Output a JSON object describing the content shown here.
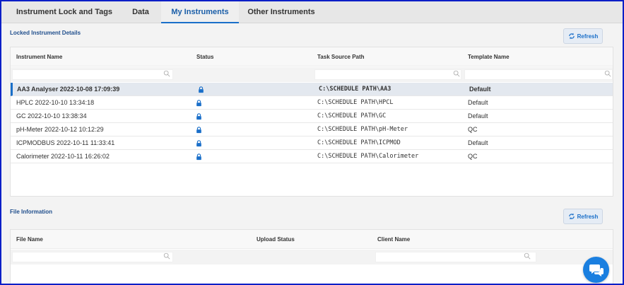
{
  "tabs": [
    {
      "label": "Instrument Lock and Tags"
    },
    {
      "label": "Data"
    },
    {
      "label": "My Instruments"
    },
    {
      "label": "Other Instruments"
    }
  ],
  "locked": {
    "title": "Locked Instrument Details",
    "refresh_label": "Refresh",
    "columns": [
      "Instrument Name",
      "Status",
      "Task Source Path",
      "Template Name"
    ],
    "rows": [
      {
        "name": "AA3 Analyser 2022-10-08 17:09:39",
        "path": "C:\\SCHEDULE PATH\\AA3",
        "template": "Default"
      },
      {
        "name": "HPLC 2022-10-10 13:34:18",
        "path": "C:\\SCHEDULE PATH\\HPCL",
        "template": "Default"
      },
      {
        "name": "GC 2022-10-10 13:38:34",
        "path": "C:\\SCHEDULE PATH\\GC",
        "template": "Default"
      },
      {
        "name": "pH-Meter 2022-10-12 10:12:29",
        "path": "C:\\SCHEDULE PATH\\pH-Meter",
        "template": "QC"
      },
      {
        "name": "ICPMODBUS 2022-10-11 11:33:41",
        "path": "C:\\SCHEDULE PATH\\ICPMOD",
        "template": "Default"
      },
      {
        "name": "Calorimeter 2022-10-11 16:26:02",
        "path": "C:\\SCHEDULE PATH\\Calorimeter",
        "template": "QC"
      }
    ]
  },
  "files": {
    "title": "File Information",
    "refresh_label": "Refresh",
    "columns": [
      "File Name",
      "Upload Status",
      "Client Name"
    ]
  },
  "icons": {
    "status": "lock-icon",
    "filter": "search-icon",
    "refresh": "refresh-icon",
    "chat": "chat-bubbles-icon"
  },
  "colors": {
    "accent": "#1a6fc9",
    "frame": "#0a1fc7",
    "chat": "#1a7fe0"
  }
}
